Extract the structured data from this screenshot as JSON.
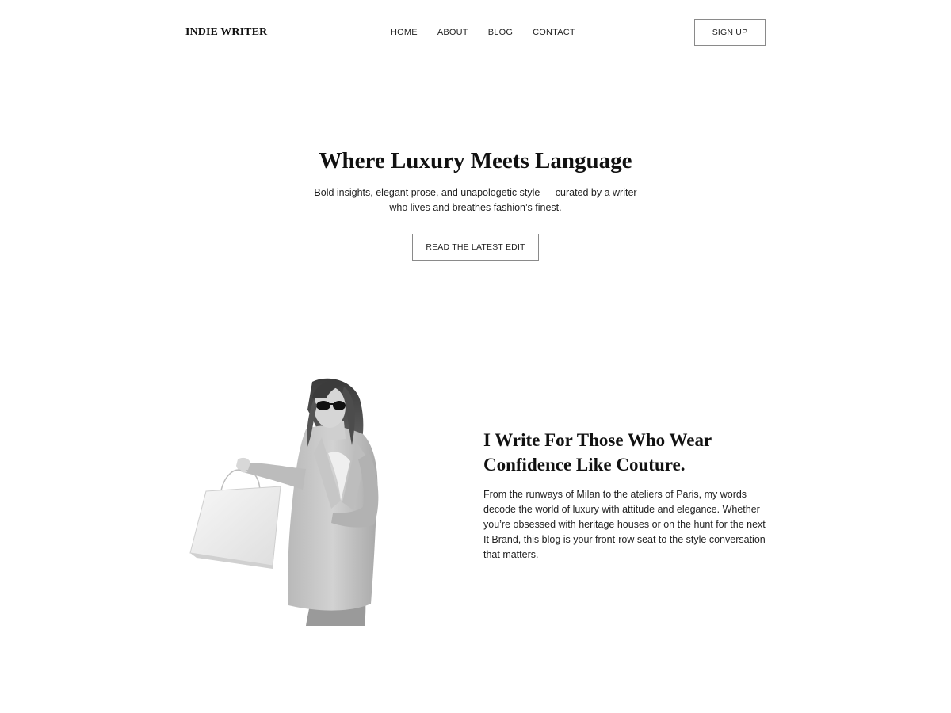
{
  "header": {
    "logo": "INDIE WRITER",
    "nav": [
      "HOME",
      "ABOUT",
      "BLOG",
      "CONTACT"
    ],
    "signup_label": "SIGN UP"
  },
  "hero": {
    "title": "Where Luxury Meets Language",
    "subtitle": "Bold insights, elegant prose, and unapologetic style — curated by a writer who lives and breathes fashion’s finest.",
    "cta_label": "READ THE LATEST EDIT"
  },
  "about": {
    "image": "woman-with-shopping-bag-photo",
    "title": "I Write For Those Who Wear Confidence Like Couture.",
    "body": "From the runways of Milan to the ateliers of Paris, my words decode the world of luxury with attitude and elegance. Whether you’re obsessed with heritage houses or on the hunt for the next It Brand, this blog is your front-row seat to the style conversation that matters."
  },
  "colors": {
    "background": "#ffffff",
    "text": "#111111",
    "border": "#8a8a8a"
  }
}
